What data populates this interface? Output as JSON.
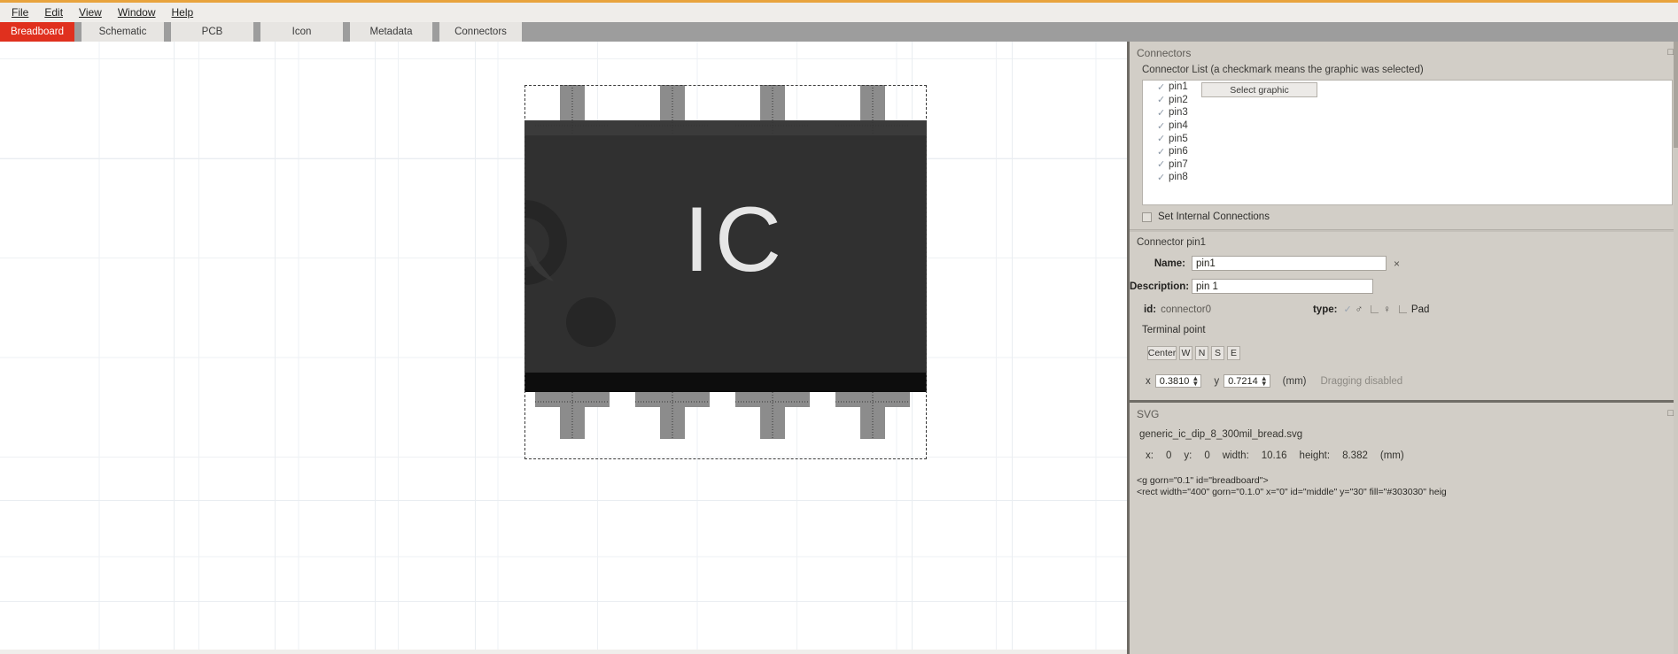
{
  "menu": {
    "items": [
      {
        "label": "File",
        "accel": "F"
      },
      {
        "label": "Edit",
        "accel": "E"
      },
      {
        "label": "View",
        "accel": "V"
      },
      {
        "label": "Window",
        "accel": "W"
      },
      {
        "label": "Help",
        "accel": "H"
      }
    ]
  },
  "tabs": {
    "active_index": 0,
    "items": [
      {
        "label": "Breadboard"
      },
      {
        "label": "Schematic"
      },
      {
        "label": "PCB"
      },
      {
        "label": "Icon"
      },
      {
        "label": "Metadata"
      },
      {
        "label": "Connectors"
      }
    ],
    "active_bg": "#e0301e",
    "active_fg": "#ffffff",
    "bar_bg": "#9d9d9d"
  },
  "connectors_panel": {
    "title": "Connectors",
    "list_label": "Connector List (a checkmark means the graphic was selected)",
    "select_graphic_button": "Select graphic",
    "pins": [
      {
        "label": "pin1",
        "checked": true
      },
      {
        "label": "pin2",
        "checked": true
      },
      {
        "label": "pin3",
        "checked": true
      },
      {
        "label": "pin4",
        "checked": true
      },
      {
        "label": "pin5",
        "checked": true
      },
      {
        "label": "pin6",
        "checked": true
      },
      {
        "label": "pin7",
        "checked": true
      },
      {
        "label": "pin8",
        "checked": true
      }
    ],
    "set_internal_connections": {
      "label": "Set Internal Connections",
      "checked": false
    }
  },
  "connector_detail": {
    "heading": "Connector pin1",
    "name_label": "Name:",
    "name_value": "pin1",
    "clear_icon": "×",
    "description_label": "Description:",
    "description_value": "pin 1",
    "id_label": "id:",
    "id_value": "connector0",
    "type_label": "type:",
    "type_male_checked": true,
    "type_pad_label": "Pad",
    "terminal_point_label": "Terminal point",
    "direction_buttons": [
      {
        "label": "Center"
      },
      {
        "label": "W"
      },
      {
        "label": "N"
      },
      {
        "label": "S"
      },
      {
        "label": "E"
      }
    ],
    "x_label": "x",
    "x_value": "0.3810",
    "y_label": "y",
    "y_value": "0.7214",
    "unit": "(mm)",
    "drag_status": "Dragging disabled"
  },
  "svg_panel": {
    "title": "SVG",
    "filename": "generic_ic_dip_8_300mil_bread.svg",
    "dims": [
      {
        "key": "x:",
        "value": "0"
      },
      {
        "key": "y:",
        "value": "0"
      },
      {
        "key": "width:",
        "value": "10.16"
      },
      {
        "key": "height:",
        "value": "8.382"
      },
      {
        "key": "(mm)",
        "value": ""
      }
    ],
    "xml_line1": "<g gorn=\"0.1\" id=\"breadboard\">",
    "xml_line2": "<rect width=\"400\" gorn=\"0.1.0\" x=\"0\" id=\"middle\" y=\"30\" fill=\"#303030\" heig"
  },
  "canvas": {
    "part_label": "IC",
    "body_color": "#303030",
    "pin_color": "#8c8c8c",
    "shadow_color": "#1a1a1a",
    "label_color": "#e6e6e6",
    "pin_count_top": 4,
    "pin_count_bottom": 4
  }
}
